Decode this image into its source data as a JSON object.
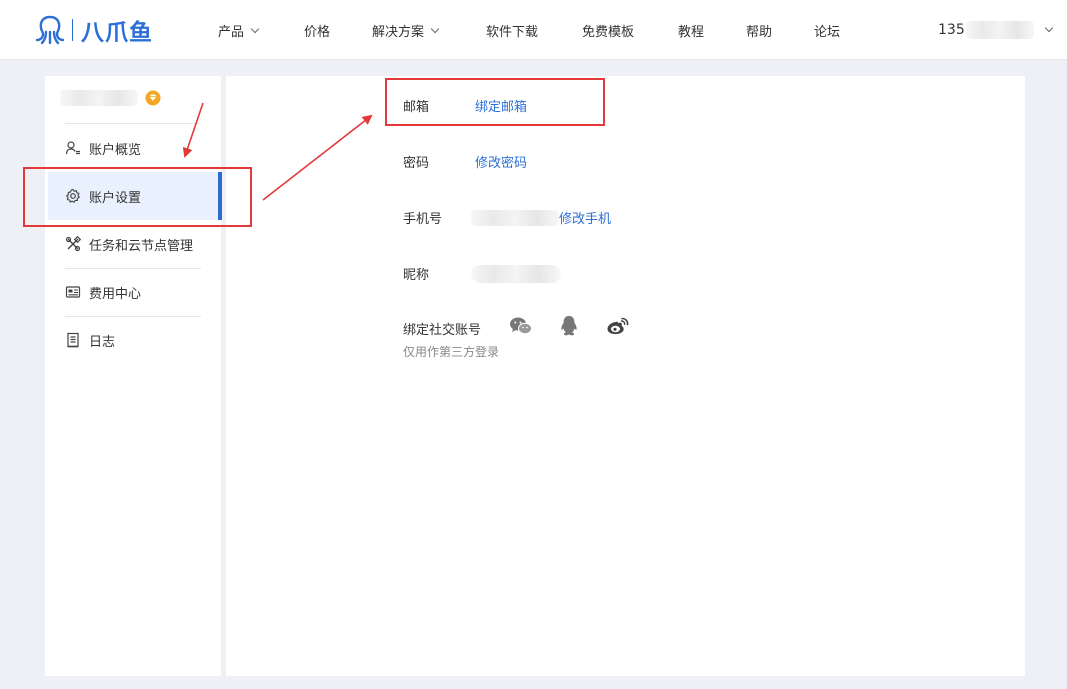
{
  "header": {
    "logo_text": "八爪鱼",
    "nav": [
      {
        "label": "产品",
        "dropdown": true
      },
      {
        "label": "价格",
        "dropdown": false
      },
      {
        "label": "解决方案",
        "dropdown": true
      },
      {
        "label": "软件下载",
        "dropdown": false
      },
      {
        "label": "免费模板",
        "dropdown": false
      },
      {
        "label": "教程",
        "dropdown": false
      },
      {
        "label": "帮助",
        "dropdown": false
      },
      {
        "label": "论坛",
        "dropdown": false
      }
    ],
    "user_prefix": "135"
  },
  "sidebar": {
    "vip_icon": "diamond-badge-icon",
    "items": [
      {
        "label": "账户概览",
        "icon": "user-icon"
      },
      {
        "label": "账户设置",
        "icon": "gear-icon",
        "active": true
      },
      {
        "label": "任务和云节点管理",
        "icon": "tools-icon"
      },
      {
        "label": "费用中心",
        "icon": "billing-card-icon"
      },
      {
        "label": "日志",
        "icon": "log-document-icon"
      }
    ]
  },
  "settings": {
    "email": {
      "label": "邮箱",
      "action": "绑定邮箱"
    },
    "password": {
      "label": "密码",
      "action": "修改密码"
    },
    "phone": {
      "label": "手机号",
      "action": "修改手机"
    },
    "nickname": {
      "label": "昵称"
    },
    "social": {
      "label": "绑定社交账号",
      "hint": "仅用作第三方登录",
      "icons": [
        "wechat-icon",
        "qq-icon",
        "weibo-icon"
      ]
    }
  },
  "colors": {
    "brand": "#2e6fd6",
    "active_bar": "#2d6bd0",
    "active_bg": "#e8f1fd",
    "annotation": "#e23a3a",
    "vip": "#f5a623"
  }
}
